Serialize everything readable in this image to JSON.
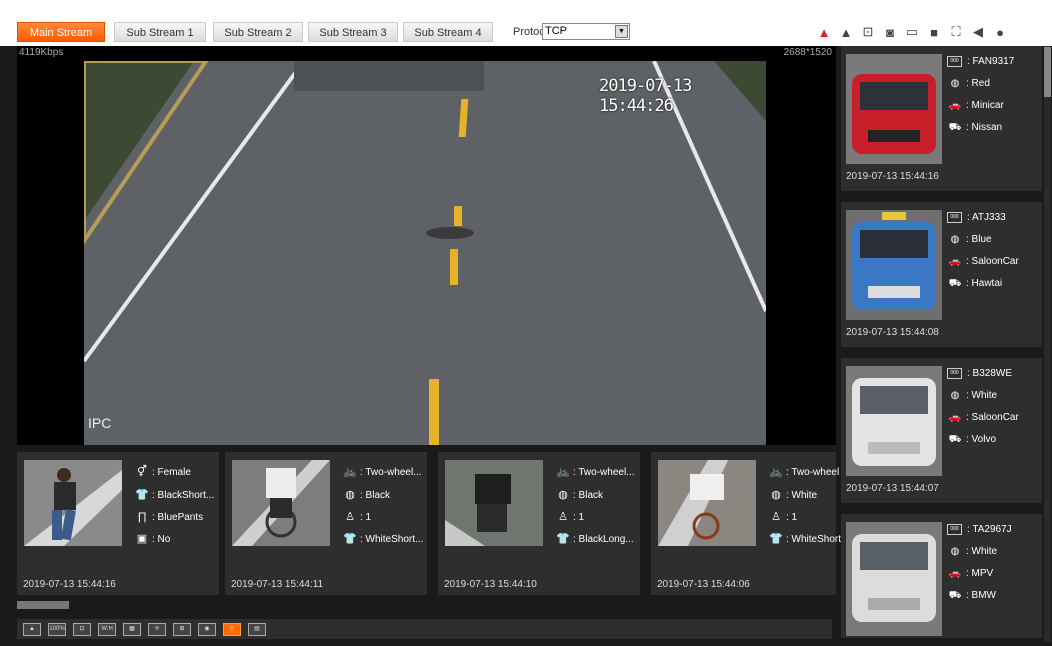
{
  "toolbar": {
    "streams": [
      "Main Stream",
      "Sub Stream 1",
      "Sub Stream 2",
      "Sub Stream 3",
      "Sub Stream 4"
    ],
    "protocol_label": "Protocol",
    "protocol_value": "TCP"
  },
  "video": {
    "bitrate": "4119Kbps",
    "resolution": "2688*1520",
    "osd_time": "2019-07-13 15:44:26",
    "osd_channel": "IPC"
  },
  "people": [
    {
      "time": "2019-07-13 15:44:16",
      "attrs": [
        {
          "icon": "gender-icon",
          "text": ": Female"
        },
        {
          "icon": "top-clothes-icon",
          "text": ": BlackShort..."
        },
        {
          "icon": "pants-icon",
          "text": ": BluePants"
        },
        {
          "icon": "bag-icon",
          "text": ": No"
        }
      ]
    },
    {
      "time": "2019-07-13 15:44:11",
      "attrs": [
        {
          "icon": "nonmotor-type-icon",
          "text": ": Two-wheel..."
        },
        {
          "icon": "color-icon",
          "text": ": Black"
        },
        {
          "icon": "rider-count-icon",
          "text": ": 1"
        },
        {
          "icon": "top-clothes-icon",
          "text": ": WhiteShort..."
        }
      ]
    },
    {
      "time": "2019-07-13 15:44:10",
      "attrs": [
        {
          "icon": "nonmotor-type-icon",
          "text": ": Two-wheel..."
        },
        {
          "icon": "color-icon",
          "text": ": Black"
        },
        {
          "icon": "rider-count-icon",
          "text": ": 1"
        },
        {
          "icon": "top-clothes-icon",
          "text": ": BlackLong..."
        }
      ]
    },
    {
      "time": "2019-07-13 15:44:06",
      "attrs": [
        {
          "icon": "nonmotor-type-icon",
          "text": ": Two-wheel"
        },
        {
          "icon": "color-icon",
          "text": ": White"
        },
        {
          "icon": "rider-count-icon",
          "text": ": 1"
        },
        {
          "icon": "top-clothes-icon",
          "text": ": WhiteShort"
        }
      ]
    }
  ],
  "vehicles": [
    {
      "time": "2019-07-13 15:44:16",
      "plate": ": FAN9317",
      "color": ": Red",
      "type": ": Minicar",
      "brand": ": Nissan",
      "car_color": "#c8202a"
    },
    {
      "time": "2019-07-13 15:44:08",
      "plate": ": ATJ333",
      "color": ": Blue",
      "type": ": SaloonCar",
      "brand": ": Hawtai",
      "car_color": "#3b78c6"
    },
    {
      "time": "2019-07-13 15:44:07",
      "plate": ": B328WE",
      "color": ": White",
      "type": ": SaloonCar",
      "brand": ": Volvo",
      "car_color": "#e4e4e4"
    },
    {
      "time": "",
      "plate": ": TA2967J",
      "color": ": White",
      "type": ": MPV",
      "brand": ": BMW",
      "car_color": "#dcdcdc"
    }
  ],
  "colors": {
    "accent": "#ff5a00",
    "panel": "#2e2e2e"
  }
}
